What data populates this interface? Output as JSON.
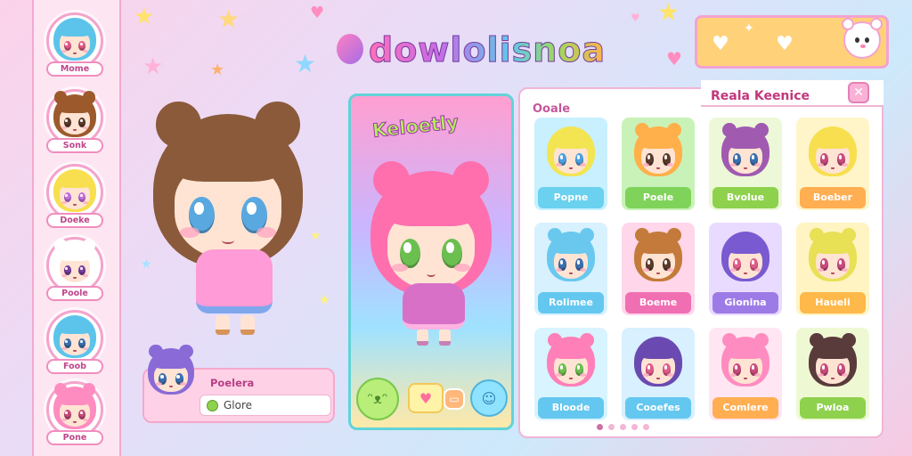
{
  "app": {
    "title": "dowlolisnoa"
  },
  "sidebar": {
    "items": [
      {
        "label": "Mome",
        "hair": "#5cc4ea",
        "eyes": "#e05a8a"
      },
      {
        "label": "Sonk",
        "hair": "#9c5a2c",
        "eyes": "#5a3b2a"
      },
      {
        "label": "Doeke",
        "hair": "#f7df4f",
        "eyes": "#c26fe0"
      },
      {
        "label": "Poole",
        "hair": "#ffffff",
        "eyes": "#7a3da0"
      },
      {
        "label": "Foob",
        "hair": "#5cc4ea",
        "eyes": "#3a6fb0"
      },
      {
        "label": "Pone",
        "hair": "#ff8cc0",
        "eyes": "#c94a7c"
      }
    ]
  },
  "preview": {
    "hair": "#8a5a3a",
    "eyes": "#5aa8e0",
    "dress": "#ff8fd0",
    "name_card": {
      "title": "Poelera",
      "value": "Glore"
    }
  },
  "center_card": {
    "title": "Keloetly",
    "hair": "#ff6fae",
    "eyes": "#6bbf4f",
    "dress": "#d870c8"
  },
  "gallery": {
    "header": "Reala Keenice",
    "section_title": "Ooale",
    "close": "✕",
    "tiles": [
      {
        "label": "Popne",
        "hair": "#f3e452",
        "eyes": "#4aa0e0",
        "bg": "#c8f0ff",
        "tab": "#6ad1ef"
      },
      {
        "label": "Poele",
        "hair": "#ffb04a",
        "eyes": "#5a3b2a",
        "bg": "#c9f2b8",
        "tab": "#7fd35a"
      },
      {
        "label": "Bvolue",
        "hair": "#a05ab0",
        "eyes": "#3a6fb0",
        "bg": "#ecf8d8",
        "tab": "#8ed14d"
      },
      {
        "label": "Boeber",
        "hair": "#f7df4f",
        "eyes": "#c94a7c",
        "bg": "#fff5c8",
        "tab": "#ffae52"
      },
      {
        "label": "Rolimee",
        "hair": "#6ac8ef",
        "eyes": "#3a6fb0",
        "bg": "#d7f1ff",
        "tab": "#64c7ef"
      },
      {
        "label": "Boeme",
        "hair": "#c47a3a",
        "eyes": "#5a3b2a",
        "bg": "#ffd6ea",
        "tab": "#f06fb3"
      },
      {
        "label": "Gionina",
        "hair": "#7a5ad0",
        "eyes": "#e05a8a",
        "bg": "#e9dbff",
        "tab": "#9d7be6"
      },
      {
        "label": "Haueli",
        "hair": "#e8e055",
        "eyes": "#c94a7c",
        "bg": "#fff4c2",
        "tab": "#ffb84a"
      },
      {
        "label": "Bloode",
        "hair": "#ff7fb8",
        "eyes": "#6bbf4f",
        "bg": "#d8f4ff",
        "tab": "#64c7ef"
      },
      {
        "label": "Cooefes",
        "hair": "#6a4ab0",
        "eyes": "#e05a8a",
        "bg": "#d8f0ff",
        "tab": "#64c7ef"
      },
      {
        "label": "Comlere",
        "hair": "#ff8cc0",
        "eyes": "#c94a7c",
        "bg": "#ffe6f2",
        "tab": "#ffae52"
      },
      {
        "label": "Pwloa",
        "hair": "#5a3b3b",
        "eyes": "#c94a7c",
        "bg": "#eef9d4",
        "tab": "#8ed14d"
      }
    ],
    "page_count": 5,
    "active_page": 1
  },
  "colors": {
    "accent_pink": "#f08dbe",
    "accent_teal": "#62d3d8",
    "bar_yellow": "#ffd27a"
  }
}
